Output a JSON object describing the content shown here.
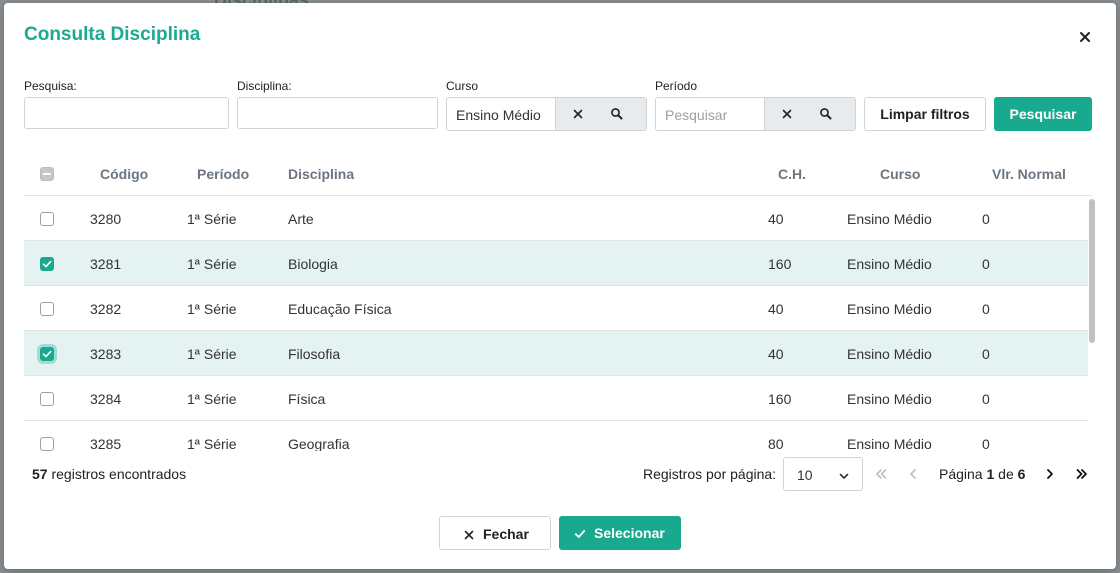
{
  "backdrop": {
    "title": "Disciplinas"
  },
  "modal": {
    "title": "Consulta Disciplina",
    "close_icon": "close-icon"
  },
  "filters": {
    "pesquisa": {
      "label": "Pesquisa:",
      "value": ""
    },
    "disciplina": {
      "label": "Disciplina:",
      "value": ""
    },
    "curso": {
      "label": "Curso",
      "value": "Ensino Médio"
    },
    "periodo": {
      "label": "Período",
      "value": "",
      "placeholder": "Pesquisar"
    },
    "clear_button": "Limpar filtros",
    "search_button": "Pesquisar"
  },
  "table": {
    "columns": [
      "Código",
      "Período",
      "Disciplina",
      "C.H.",
      "Curso",
      "Vlr. Normal"
    ],
    "rows": [
      {
        "checked": false,
        "codigo": "3280",
        "periodo": "1ª Série",
        "disciplina": "Arte",
        "ch": "40",
        "curso": "Ensino Médio",
        "vlr": "0"
      },
      {
        "checked": true,
        "codigo": "3281",
        "periodo": "1ª Série",
        "disciplina": "Biologia",
        "ch": "160",
        "curso": "Ensino Médio",
        "vlr": "0"
      },
      {
        "checked": false,
        "codigo": "3282",
        "periodo": "1ª Série",
        "disciplina": "Educação Física",
        "ch": "40",
        "curso": "Ensino Médio",
        "vlr": "0"
      },
      {
        "checked": true,
        "codigo": "3283",
        "periodo": "1ª Série",
        "disciplina": "Filosofia",
        "ch": "40",
        "curso": "Ensino Médio",
        "vlr": "0"
      },
      {
        "checked": false,
        "codigo": "3284",
        "periodo": "1ª Série",
        "disciplina": "Física",
        "ch": "160",
        "curso": "Ensino Médio",
        "vlr": "0"
      },
      {
        "checked": false,
        "codigo": "3285",
        "periodo": "1ª Série",
        "disciplina": "Geografia",
        "ch": "80",
        "curso": "Ensino Médio",
        "vlr": "0"
      }
    ]
  },
  "footer": {
    "count": "57",
    "count_suffix": " registros encontrados",
    "per_page_label": "Registros por página:",
    "per_page_value": "10",
    "page_prefix": "Página ",
    "page_current": "1",
    "page_of": " de ",
    "page_total": "6"
  },
  "actions": {
    "close_label": "Fechar",
    "select_label": "Selecionar"
  },
  "colors": {
    "accent": "#19a98f",
    "selected_row": "#e4f2f2",
    "title": "#1aaa90"
  }
}
